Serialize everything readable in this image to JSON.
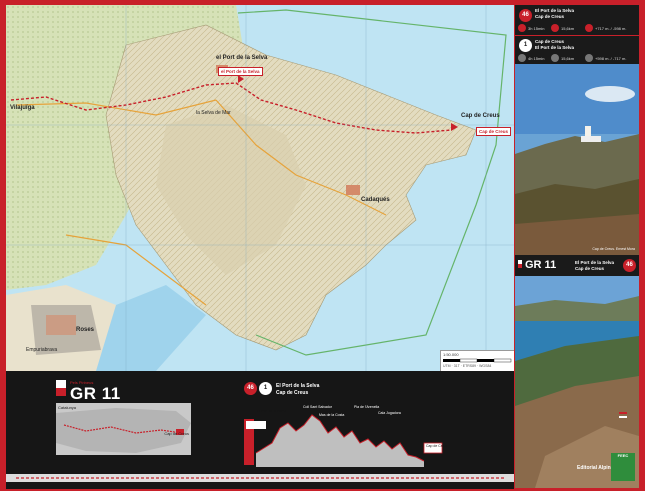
{
  "map": {
    "places": [
      {
        "name": "Vilajuïga"
      },
      {
        "name": "el Port de la Selva"
      },
      {
        "name": "Cap de Creus"
      },
      {
        "name": "Cadaqués"
      },
      {
        "name": "Roses"
      },
      {
        "name": "la Selva de Mar"
      },
      {
        "name": "Empuriabrava"
      }
    ],
    "route_labels": [
      {
        "text": "el Port de la Selva"
      },
      {
        "text": "Cap de Creus"
      }
    ],
    "scale": {
      "label": "1:50.000",
      "coords": "UTM · 31T · ETRS89 · WGS84"
    }
  },
  "bottom": {
    "gr_sup": "Pels Pirineus",
    "gr_label": "GR 11",
    "overview_label": "Catalunya",
    "overview_end": "Cap de Creus",
    "stage_badge": "46",
    "stage_index": "1",
    "stage_from": "El Port de la Selva",
    "stage_to": "Cap de Creus",
    "profile_points": [
      "El Port de la Selva",
      "Coll Sant Salvador",
      "Mas de la Costa",
      "Pla de l'Arenella",
      "Cala Jugadora",
      "Cap de Creus"
    ]
  },
  "right": {
    "stage_a": {
      "badge": "46",
      "line1": "El Port de la Selva",
      "line2": "Cap de Creus",
      "time": "3h 15min",
      "dist": "15,6km",
      "elev": "+717 m. / -598 m."
    },
    "stage_b": {
      "badge": "1",
      "line1": "Cap de Creus",
      "line2": "El Port de la Selva",
      "time": "4h 15min",
      "dist": "15,6km",
      "elev": "+598 m. / -717 m."
    },
    "gr_band": {
      "label": "GR 11",
      "line1": "El Port de la Selva",
      "line2": "Cap de Creus",
      "badge": "46"
    },
    "caption": "Cap de Creus. Ernest Mora"
  },
  "logos": {
    "publisher": "Editorial Alpina",
    "green": "FEEC"
  },
  "colors": {
    "accent": "#c8202a",
    "sea": "#bfe4f3",
    "panel": "#161616"
  }
}
